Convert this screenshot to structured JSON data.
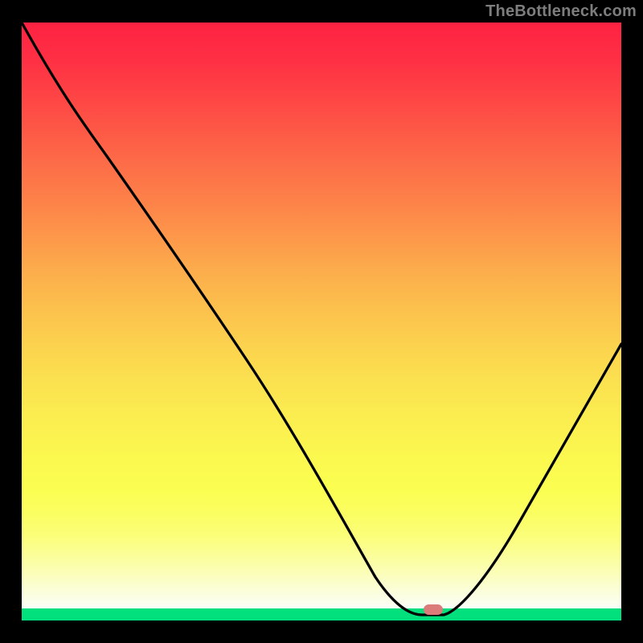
{
  "watermark": "TheBottleneck.com",
  "marker_color": "#db7b7a",
  "chart_data": {
    "type": "line",
    "title": "",
    "xlabel": "",
    "ylabel": "",
    "xlim": [
      0,
      100
    ],
    "ylim": [
      0,
      100
    ],
    "series": [
      {
        "name": "curve",
        "x": [
          0,
          12,
          20,
          30,
          40,
          50,
          58,
          62,
          66,
          70,
          74,
          80,
          88,
          100
        ],
        "values": [
          100,
          82,
          70,
          57,
          43,
          30,
          16,
          8,
          2,
          0,
          3,
          14,
          30,
          55
        ]
      }
    ],
    "annotations": [
      {
        "name": "marker",
        "x": 68,
        "y": 1
      }
    ],
    "background": "red-yellow-green-gradient"
  }
}
